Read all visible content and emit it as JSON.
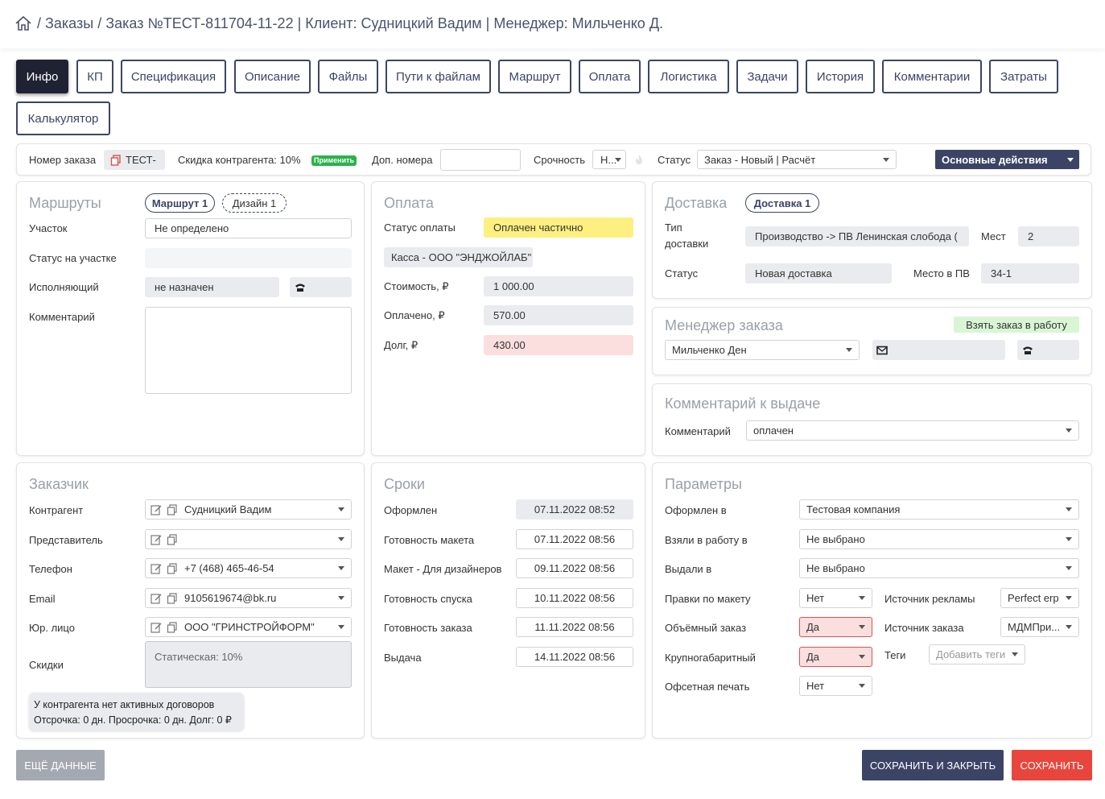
{
  "breadcrumb": {
    "sep1": "/",
    "orders": "Заказы",
    "sep2": "/",
    "order": "Заказ №ТЕСТ-811704-11-22",
    "client": "| Клиент: Судницкий Вадим",
    "manager": "| Менеджер: Мильченко Д."
  },
  "tabs": [
    "Инфо",
    "КП",
    "Спецификация",
    "Описание",
    "Файлы",
    "Пути к файлам",
    "Маршрут",
    "Оплата",
    "Логистика",
    "Задачи",
    "История",
    "Комментарии",
    "Затраты",
    "Калькулятор"
  ],
  "toolbar": {
    "order_number_label": "Номер заказа",
    "order_number_value": "ТЕСТ-",
    "discount_label": "Скидка контрагента: 10%",
    "apply_label": "Применить",
    "extra_numbers_label": "Доп. номера",
    "extra_numbers_value": "",
    "urgency_label": "Срочность",
    "urgency_value": "Н...",
    "status_label": "Статус",
    "status_value": "Заказ - Новый | Расчёт",
    "main_actions": "Основные действия"
  },
  "routes": {
    "title": "Маршруты",
    "route_pill": "Маршрут 1",
    "design_pill": "Дизайн 1",
    "section_label": "Участок",
    "section_value": "Не определено",
    "section_status_label": "Статус на участке",
    "section_status_value": "",
    "executor_label": "Исполняющий",
    "executor_value": "не назначен",
    "executor_phone": "",
    "comment_label": "Комментарий",
    "comment_value": ""
  },
  "payment": {
    "title": "Оплата",
    "status_label": "Статус оплаты",
    "status_value": "Оплачен частично",
    "cashbox": "Касса - ООО \"ЭНДЖОЙЛАБ\"",
    "cost_label": "Стоимость, ₽",
    "cost_value": "1 000.00",
    "paid_label": "Оплачено, ₽",
    "paid_value": "570.00",
    "debt_label": "Долг, ₽",
    "debt_value": "430.00"
  },
  "delivery": {
    "title": "Доставка",
    "delivery_pill": "Доставка 1",
    "type_label_1": "Тип",
    "type_label_2": "доставки",
    "type_value": "Производство -> ПВ Ленинская слобода (",
    "places_label": "Мест",
    "places_value": "2",
    "status_label": "Статус",
    "status_value": "Новая доставка",
    "pv_place_label": "Место в ПВ",
    "pv_place_value": "34-1"
  },
  "manager": {
    "title": "Менеджер заказа",
    "take_label": "Взять заказ в работу",
    "manager_value": "Мильченко Ден",
    "email_value": "",
    "phone_value": ""
  },
  "issue_comment": {
    "title": "Комментарий к выдаче",
    "comment_label": "Комментарий",
    "comment_value": "оплачен"
  },
  "customer": {
    "title": "Заказчик",
    "counterparty_label": "Контрагент",
    "counterparty_value": "Судницкий Вадим",
    "representative_label": "Представитель",
    "representative_value": "",
    "phone_label": "Телефон",
    "phone_value": "+7 (468) 465-46-54",
    "email_label": "Email",
    "email_value": "9105619674@bk.ru",
    "legal_label": "Юр. лицо",
    "legal_value": "ООО \"ГРИНСТРОЙФОРМ\"",
    "discounts_label": "Скидки",
    "discounts_value": "Статическая: 10%",
    "contract_line1": "У контрагента нет активных договоров",
    "contract_line2": "Отсрочка: 0 дн. Просрочка: 0 дн. Долг: 0 ₽"
  },
  "deadlines": {
    "title": "Сроки",
    "rows": [
      {
        "label": "Оформлен",
        "value": "07.11.2022 08:52"
      },
      {
        "label": "Готовность макета",
        "value": "07.11.2022 08:56"
      },
      {
        "label": "Макет - Для дизайнеров",
        "value": "09.11.2022 08:56"
      },
      {
        "label": "Готовность спуска",
        "value": "10.11.2022 08:56"
      },
      {
        "label": "Готовность заказа",
        "value": "11.11.2022 08:56"
      },
      {
        "label": "Выдача",
        "value": "14.11.2022 08:56"
      }
    ]
  },
  "params": {
    "title": "Параметры",
    "issued_in_label": "Оформлен в",
    "issued_in_value": "Тестовая компания",
    "taken_in_label": "Взяли в работу в",
    "taken_in_value": "Не выбрано",
    "given_in_label": "Выдали в",
    "given_in_value": "Не выбрано",
    "edits_label": "Правки по макету",
    "edits_value": "Нет",
    "ad_source_label": "Источник рекламы",
    "ad_source_value": "Perfect erp",
    "bulky_label": "Объёмный заказ",
    "bulky_value": "Да",
    "order_source_label": "Источник заказа",
    "order_source_value": "МДМПри...",
    "large_label": "Крупногабаритный",
    "large_value": "Да",
    "tags_label": "Теги",
    "tags_placeholder": "Добавить теги",
    "offset_label": "Офсетная печать",
    "offset_value": "Нет"
  },
  "footer": {
    "more_data": "ЕЩЁ ДАННЫЕ",
    "save_close": "СОХРАНИТЬ И ЗАКРЫТЬ",
    "save": "СОХРАНИТЬ"
  },
  "colors": {
    "dark": "#1e2233",
    "navy": "#3c4466",
    "save_red": "#e8453c",
    "more_gray": "#a4a8b0",
    "apply_green": "#2bb24c"
  }
}
